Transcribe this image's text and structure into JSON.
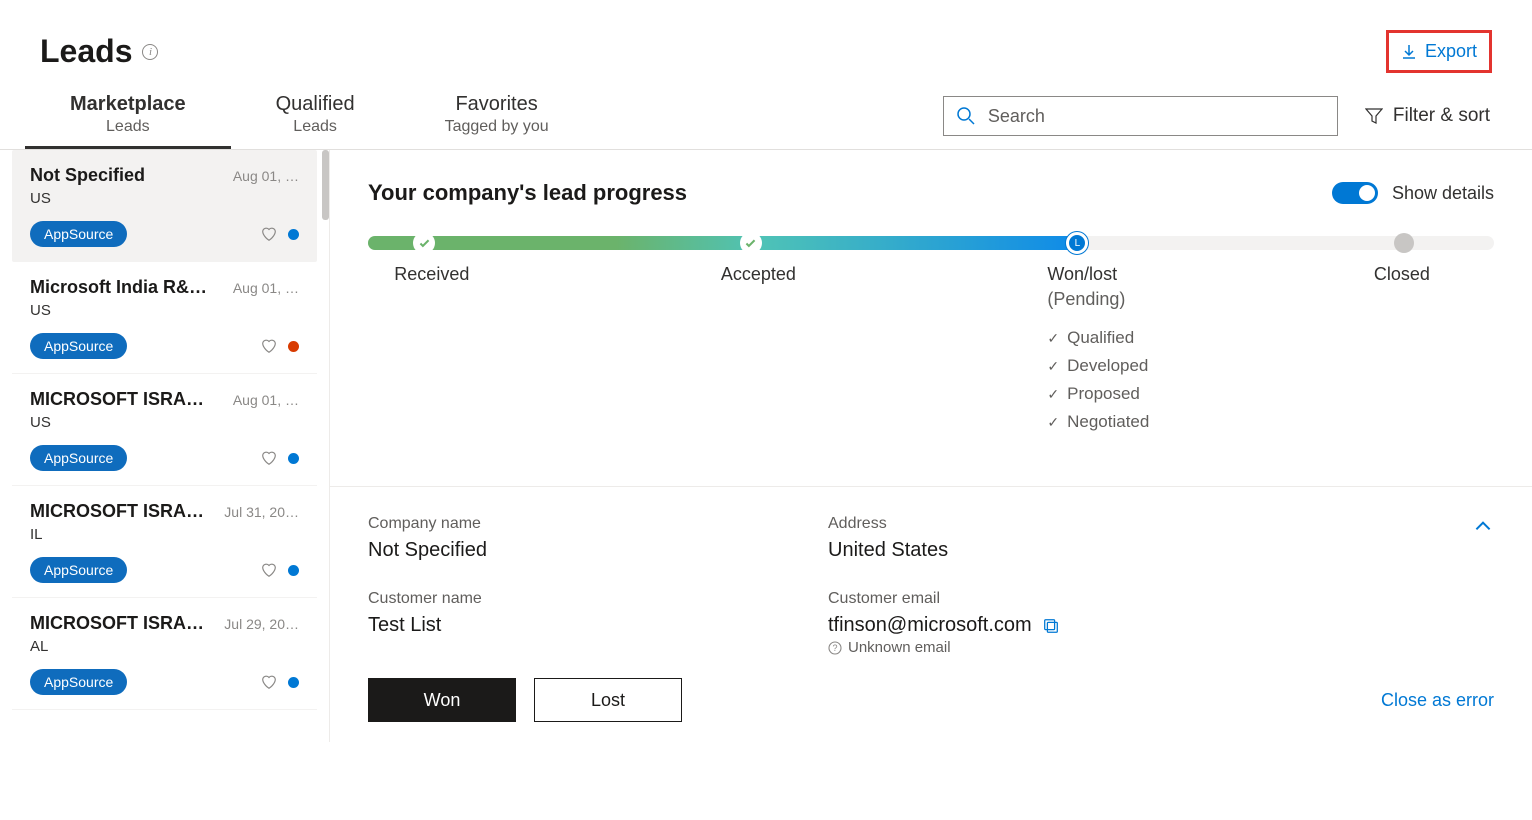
{
  "header": {
    "title": "Leads",
    "export_label": "Export"
  },
  "tabs": [
    {
      "title": "Marketplace",
      "subtitle": "Leads"
    },
    {
      "title": "Qualified",
      "subtitle": "Leads"
    },
    {
      "title": "Favorites",
      "subtitle": "Tagged by you"
    }
  ],
  "search": {
    "placeholder": "Search"
  },
  "filter_label": "Filter & sort",
  "leads": [
    {
      "name": "Not Specified",
      "date": "Aug 01, …",
      "location": "US",
      "source": "AppSource",
      "dot": "blue"
    },
    {
      "name": "Microsoft India R&…",
      "date": "Aug 01, …",
      "location": "US",
      "source": "AppSource",
      "dot": "orange"
    },
    {
      "name": "MICROSOFT ISRAE…",
      "date": "Aug 01, …",
      "location": "US",
      "source": "AppSource",
      "dot": "blue"
    },
    {
      "name": "MICROSOFT ISRAE…",
      "date": "Jul 31, 20…",
      "location": "IL",
      "source": "AppSource",
      "dot": "blue"
    },
    {
      "name": "MICROSOFT ISRAE…",
      "date": "Jul 29, 20…",
      "location": "AL",
      "source": "AppSource",
      "dot": "blue"
    }
  ],
  "progress": {
    "title": "Your company's lead progress",
    "toggle_label": "Show details",
    "stages": {
      "s1": "Received",
      "s2": "Accepted",
      "s3": "Won/lost",
      "s3_sub": "(Pending)",
      "s4": "Closed"
    },
    "checks": [
      "Qualified",
      "Developed",
      "Proposed",
      "Negotiated"
    ]
  },
  "details": {
    "company_name_label": "Company name",
    "company_name": "Not Specified",
    "address_label": "Address",
    "address": "United States",
    "customer_name_label": "Customer name",
    "customer_name": "Test List",
    "customer_email_label": "Customer email",
    "customer_email": "tfinson@microsoft.com",
    "unknown_email": "Unknown email"
  },
  "actions": {
    "won": "Won",
    "lost": "Lost",
    "close_error": "Close as error"
  }
}
